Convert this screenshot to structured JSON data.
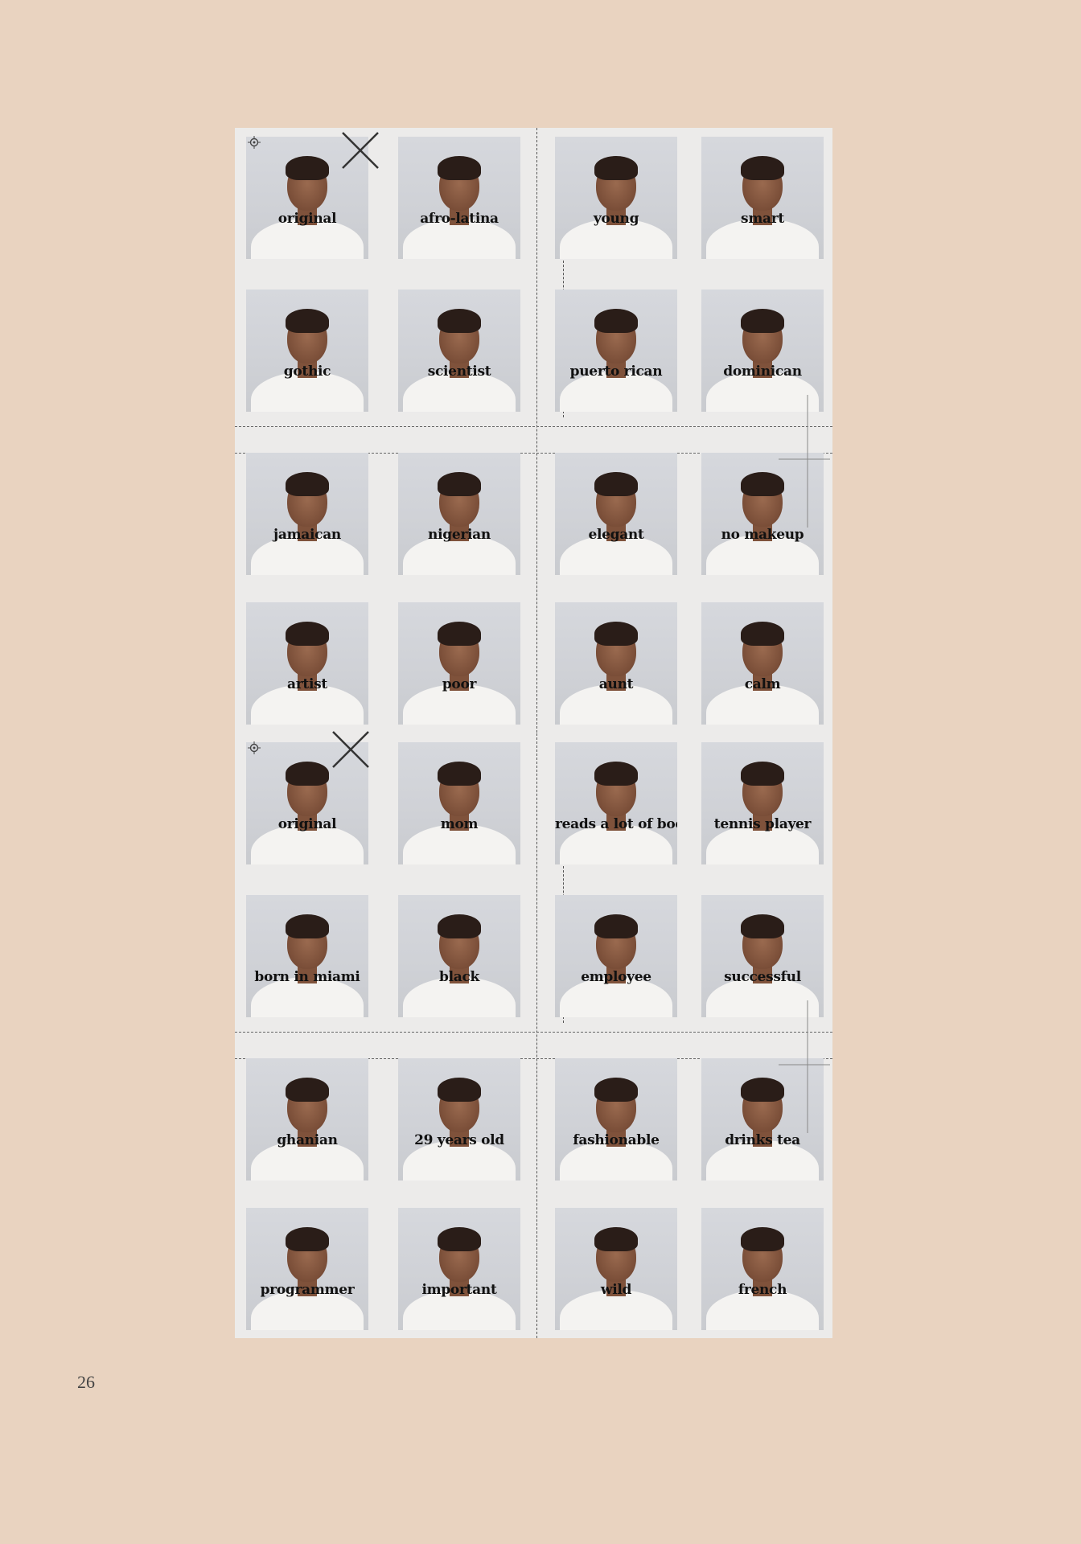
{
  "page": {
    "number": "26",
    "background": "#e9d3c0"
  },
  "sheets": [
    {
      "labels": [
        "original",
        "afro-latina",
        "young",
        "smart",
        "gothic",
        "scientist",
        "puerto rican",
        "dominican",
        "jamaican",
        "nigerian",
        "elegant",
        "no makeup",
        "artist",
        "poor",
        "aunt",
        "calm"
      ]
    },
    {
      "labels": [
        "original",
        "mom",
        "reads a lot of books",
        "tennis player",
        "born in miami",
        "black",
        "employee",
        "successful",
        "ghanian",
        "29 years old",
        "fashionable",
        "drinks tea",
        "programmer",
        "important",
        "wild",
        "french"
      ]
    }
  ],
  "icons": {
    "cross": "x-mark-icon",
    "target": "crosshair-target-icon"
  }
}
